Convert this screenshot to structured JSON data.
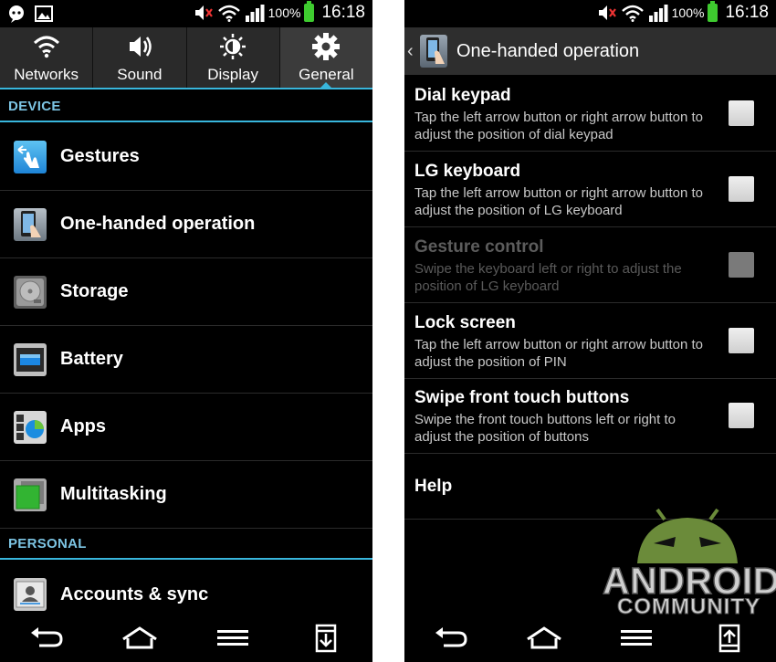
{
  "left": {
    "status": {
      "battery_pct": "100%",
      "time": "16:18"
    },
    "tabs": [
      {
        "label": "Networks",
        "icon": "wifi-icon"
      },
      {
        "label": "Sound",
        "icon": "speaker-icon"
      },
      {
        "label": "Display",
        "icon": "brightness-icon"
      },
      {
        "label": "General",
        "icon": "gear-icon",
        "active": true
      }
    ],
    "section_device": "DEVICE",
    "items": [
      {
        "label": "Gestures",
        "icon": "gestures-icon"
      },
      {
        "label": "One-handed operation",
        "icon": "one-hand-icon"
      },
      {
        "label": "Storage",
        "icon": "storage-icon"
      },
      {
        "label": "Battery",
        "icon": "battery-settings-icon"
      },
      {
        "label": "Apps",
        "icon": "apps-icon"
      },
      {
        "label": "Multitasking",
        "icon": "multitasking-icon"
      }
    ],
    "section_personal": "PERSONAL",
    "personal_items": [
      {
        "label": "Accounts & sync",
        "icon": "accounts-icon"
      }
    ]
  },
  "right": {
    "status": {
      "battery_pct": "100%",
      "time": "16:18"
    },
    "title": "One-handed operation",
    "options": [
      {
        "title": "Dial keypad",
        "desc": "Tap the left arrow button or right arrow button to adjust the position of dial keypad",
        "enabled": true,
        "checked": false
      },
      {
        "title": "LG keyboard",
        "desc": "Tap the left arrow button or right arrow button to adjust the position of LG keyboard",
        "enabled": true,
        "checked": false
      },
      {
        "title": "Gesture control",
        "desc": "Swipe the keyboard left or right to adjust the position of LG keyboard",
        "enabled": false,
        "checked": false
      },
      {
        "title": "Lock screen",
        "desc": "Tap the left arrow button or right arrow button to adjust the position of PIN",
        "enabled": true,
        "checked": false
      },
      {
        "title": "Swipe front touch buttons",
        "desc": "Swipe the front touch buttons left or right to adjust the position of buttons",
        "enabled": true,
        "checked": false
      }
    ],
    "help": "Help"
  },
  "watermark": {
    "line1": "ANDROID",
    "line2": "COMMUNITY"
  },
  "colors": {
    "accent": "#38b6dc",
    "section_text": "#7cc4e3",
    "background": "#000000",
    "tab_bg": "#2a2a2a"
  }
}
